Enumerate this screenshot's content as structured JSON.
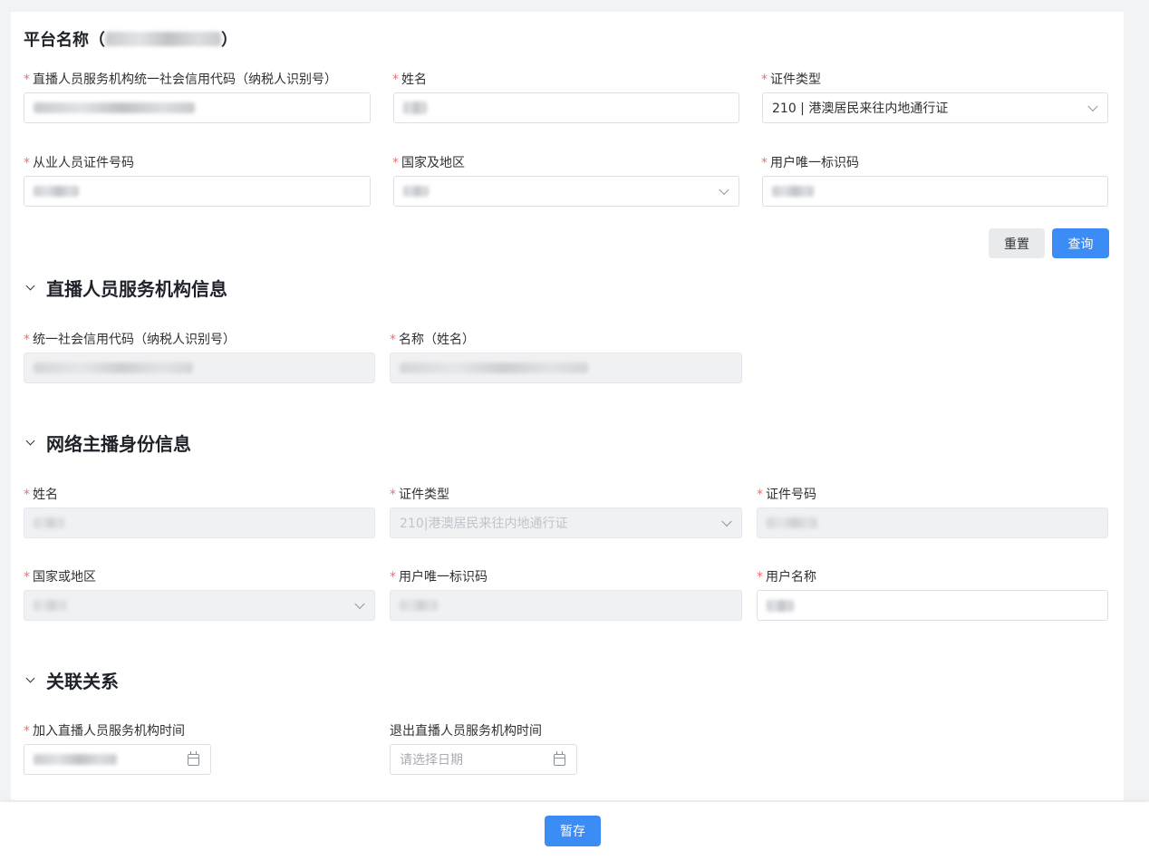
{
  "header": {
    "platform_label": "平台名称",
    "paren_open": "（",
    "paren_close": "）"
  },
  "search": {
    "credit_code": {
      "label": "直播人员服务机构统一社会信用代码（纳税人识别号）",
      "required": true
    },
    "name": {
      "label": "姓名",
      "required": true
    },
    "id_type": {
      "label": "证件类型",
      "required": true,
      "value": "210 | 港澳居民来往内地通行证"
    },
    "id_number": {
      "label": "从业人员证件号码",
      "required": true
    },
    "country": {
      "label": "国家及地区",
      "required": true
    },
    "user_id": {
      "label": "用户唯一标识码",
      "required": true
    },
    "reset_label": "重置",
    "query_label": "查询"
  },
  "org_section": {
    "title": "直播人员服务机构信息",
    "credit_code_label": "统一社会信用代码（纳税人识别号）",
    "name_label": "名称（姓名）"
  },
  "anchor_section": {
    "title": "网络主播身份信息",
    "name_label": "姓名",
    "id_type_label": "证件类型",
    "id_type_value": "210|港澳居民来往内地通行证",
    "id_number_label": "证件号码",
    "country_label": "国家或地区",
    "user_id_label": "用户唯一标识码",
    "username_label": "用户名称"
  },
  "relation_section": {
    "title": "关联关系",
    "join_time_label": "加入直播人员服务机构时间",
    "exit_time_label": "退出直播人员服务机构时间",
    "exit_time_placeholder": "请选择日期"
  },
  "footer": {
    "save_label": "暂存"
  },
  "colors": {
    "primary": "#3c8cf5",
    "required_star": "#f56c6c",
    "disabled_bg": "#f0f1f3"
  }
}
